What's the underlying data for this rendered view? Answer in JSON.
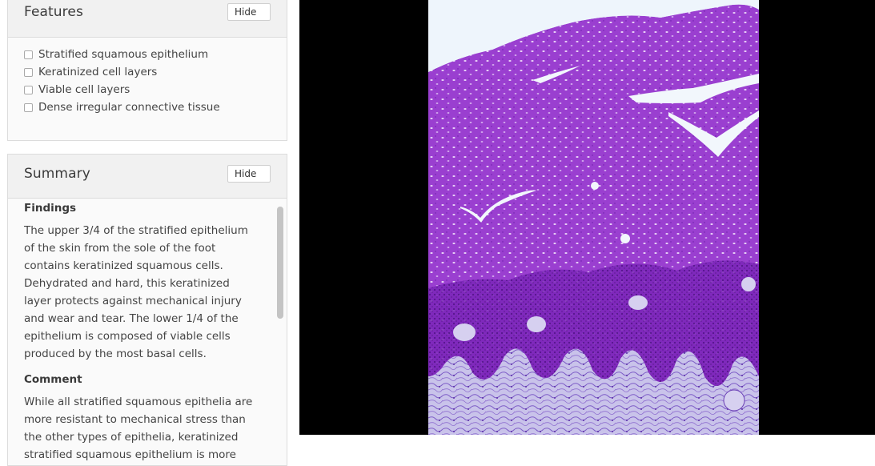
{
  "features": {
    "title": "Features",
    "hide_label": "Hide",
    "items": [
      {
        "label": "Stratified squamous epithelium",
        "checked": false
      },
      {
        "label": "Keratinized cell layers",
        "checked": false
      },
      {
        "label": "Viable cell layers",
        "checked": false
      },
      {
        "label": "Dense irregular connective tissue",
        "checked": false
      }
    ]
  },
  "summary": {
    "title": "Summary",
    "hide_label": "Hide",
    "findings_heading": "Findings",
    "findings_text": "The upper 3/4 of the stratified epithelium of the skin from the sole of the foot contains keratinized squamous cells. Dehydrated and hard, this keratinized layer protects against mechanical injury and wear and tear. The lower 1/4 of the epithelium is composed of viable cells produced by the most basal cells.",
    "comment_heading": "Comment",
    "comment_text": "While all stratified squamous epithelia are more resistant to mechanical stress than the other types of epithelia, keratinized stratified squamous epithelium is more resistant than"
  },
  "viewer": {
    "background_color": "#000000",
    "stain_color": "#9b3fcf"
  }
}
